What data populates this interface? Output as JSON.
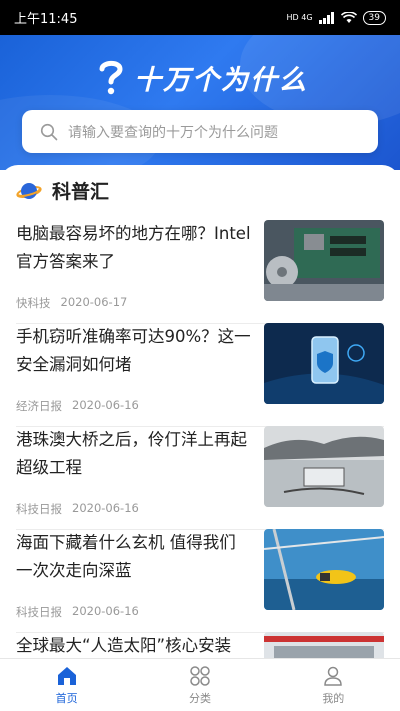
{
  "status_bar": {
    "time": "上午11:45",
    "network": "HD 4G",
    "battery": "39"
  },
  "header": {
    "title": "十万个为什么"
  },
  "search": {
    "placeholder": "请输入要查询的十万个为什么问题"
  },
  "section": {
    "title": "科普汇"
  },
  "articles": [
    {
      "title": "电脑最容易坏的地方在哪？Intel官方答案来了",
      "source": "快科技",
      "date": "2020-06-17"
    },
    {
      "title": "手机窃听准确率可达90%？这一安全漏洞如何堵",
      "source": "经济日报",
      "date": "2020-06-16"
    },
    {
      "title": "港珠澳大桥之后，伶仃洋上再起超级工程",
      "source": "科技日报",
      "date": "2020-06-16"
    },
    {
      "title": "海面下藏着什么玄机 值得我们一次次走向深蓝",
      "source": "科技日报",
      "date": "2020-06-16"
    },
    {
      "title": "全球最大“人造太阳”核心安装"
    }
  ],
  "tabs": [
    {
      "label": "首页",
      "icon": "home-icon"
    },
    {
      "label": "分类",
      "icon": "grid-icon"
    },
    {
      "label": "我的",
      "icon": "user-icon"
    }
  ],
  "colors": {
    "brand": "#1a62d8",
    "inactive": "#8a8a8a"
  }
}
